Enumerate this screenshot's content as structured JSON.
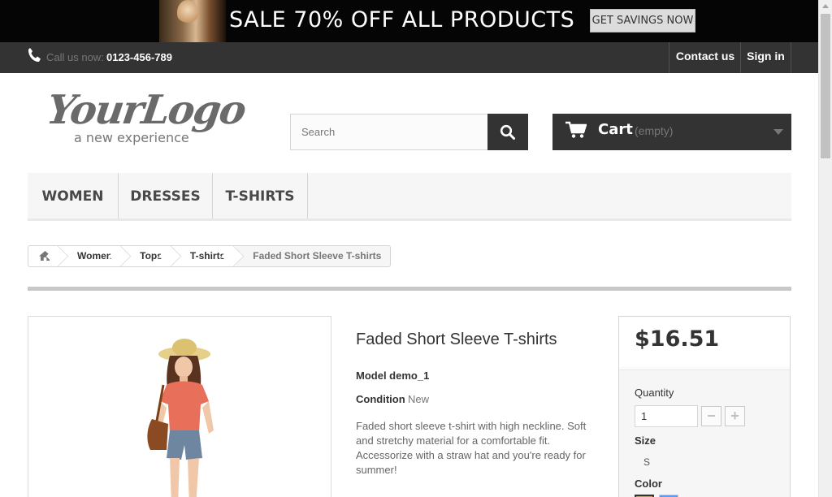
{
  "banner": {
    "headline": "SALE 70% OFF ALL PRODUCTS",
    "cta_label": "GET SAVINGS NOW"
  },
  "topbar": {
    "call_label": "Call us now:",
    "phone": "0123-456-789",
    "contact_label": "Contact us",
    "signin_label": "Sign in",
    "icons": [
      "phone-icon"
    ]
  },
  "header": {
    "logo_main": "YourLogo",
    "logo_sub": "a new experience",
    "search_placeholder": "Search",
    "cart_label": "Cart",
    "cart_status": "(empty)"
  },
  "menu": {
    "items": [
      {
        "label": "WOMEN"
      },
      {
        "label": "DRESSES"
      },
      {
        "label": "T-SHIRTS"
      }
    ]
  },
  "breadcrumb": {
    "items": [
      {
        "label": "Women"
      },
      {
        "label": "Tops"
      },
      {
        "label": "T-shirts"
      }
    ],
    "current": "Faded Short Sleeve T-shirts"
  },
  "product": {
    "title": "Faded Short Sleeve T-shirts",
    "model": "Model demo_1",
    "condition_label": "Condition",
    "condition_value": "New",
    "description": "Faded short sleeve t-shirt with high neckline. Soft and stretchy material for a comfortable fit. Accessorize with a straw hat and you're ready for summer!"
  },
  "buybox": {
    "price": "$16.51",
    "quantity_label": "Quantity",
    "quantity_value": "1",
    "minus_label": "−",
    "plus_label": "+",
    "size_label": "Size",
    "size_value": "S",
    "color_label": "Color",
    "colors": [
      "#f39c11",
      "#5d9cec"
    ]
  },
  "colors": {
    "topbar_bg": "#333333",
    "banner_bg": "#050505",
    "menu_bg": "#f6f6f6",
    "accent_dark": "#333333"
  }
}
